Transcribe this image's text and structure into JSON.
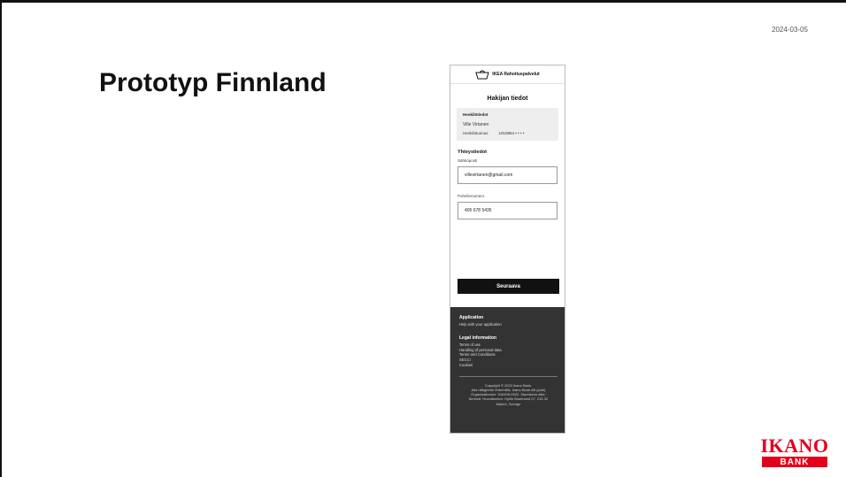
{
  "slide": {
    "date": "2024-03-05",
    "title": "Prototyp Finnland"
  },
  "phone": {
    "brand": "IKEA Rahoituspalvelut",
    "page_title": "Hakijan tiedot",
    "personal": {
      "heading": "Henkilötiedot",
      "name": "Ville Virtanen",
      "id_label": "Henkilötunnus",
      "id_value": "1010854 • • • •"
    },
    "contact": {
      "heading": "Yhteystiedot",
      "email_label": "Sähköposti",
      "email_value": "villevirtanen@gmail.com",
      "phone_label": "Puhelinnumero",
      "phone_value": "405 678 5435"
    },
    "next_button": "Seuraava",
    "footer": {
      "application_heading": "Application",
      "application_help": "Help with your application",
      "legal_heading": "Legal information",
      "legal_links": [
        "Terms of use",
        "Handling of personal data",
        "Terms and Conditions",
        "SECCI",
        "Cookies"
      ],
      "copyright_1": "Copyright © 2023 Ikano Bank.",
      "copyright_2": "Alla rättigheter förbehålls. Ikano Bank AB (publ)",
      "copyright_3": "Organisationsnr: 516406-0922. Styrelsens säte:",
      "copyright_4": "Älmhult. Huvudkontor: Hyllie Boulevard 27, 215 32",
      "copyright_5": "Malmö, Sverige"
    }
  },
  "logo": {
    "top": "IKANO",
    "bottom": "BANK",
    "color": "#e3001b"
  }
}
